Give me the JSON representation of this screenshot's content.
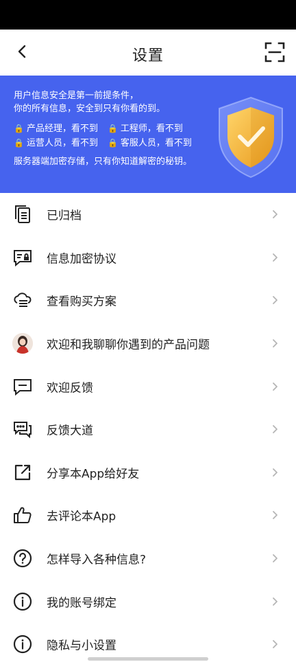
{
  "nav": {
    "title": "设置"
  },
  "banner": {
    "line1": "用户信息安全是第一前提条件，",
    "line2": "你的所有信息，安全到只有你看的到。",
    "roles": [
      {
        "label": "产品经理，看不到"
      },
      {
        "label": "工程师，看不到"
      },
      {
        "label": "运营人员，看不到"
      },
      {
        "label": "客服人员，看不到"
      }
    ],
    "line5": "服务器端加密存储，只有你知道解密的秘钥。",
    "lock_glyph": "🔒",
    "bg_color": "#4663EE",
    "shield_color": "#F2B33D"
  },
  "menu": {
    "items": [
      {
        "label": "已归档",
        "icon": "archive-icon"
      },
      {
        "label": "信息加密协议",
        "icon": "encryption-agreement-icon"
      },
      {
        "label": "查看购买方案",
        "icon": "purchase-plan-icon"
      },
      {
        "label": "欢迎和我聊聊你遇到的产品问题",
        "icon": "avatar"
      },
      {
        "label": "欢迎反馈",
        "icon": "feedback-icon"
      },
      {
        "label": "反馈大道",
        "icon": "feedback-forum-icon"
      },
      {
        "label": "分享本App给好友",
        "icon": "share-icon"
      },
      {
        "label": "去评论本App",
        "icon": "thumbs-up-icon"
      },
      {
        "label": "怎样导入各种信息?",
        "icon": "help-icon"
      },
      {
        "label": "我的账号绑定",
        "icon": "info-icon"
      },
      {
        "label": "隐私与小设置",
        "icon": "info-icon"
      }
    ]
  }
}
